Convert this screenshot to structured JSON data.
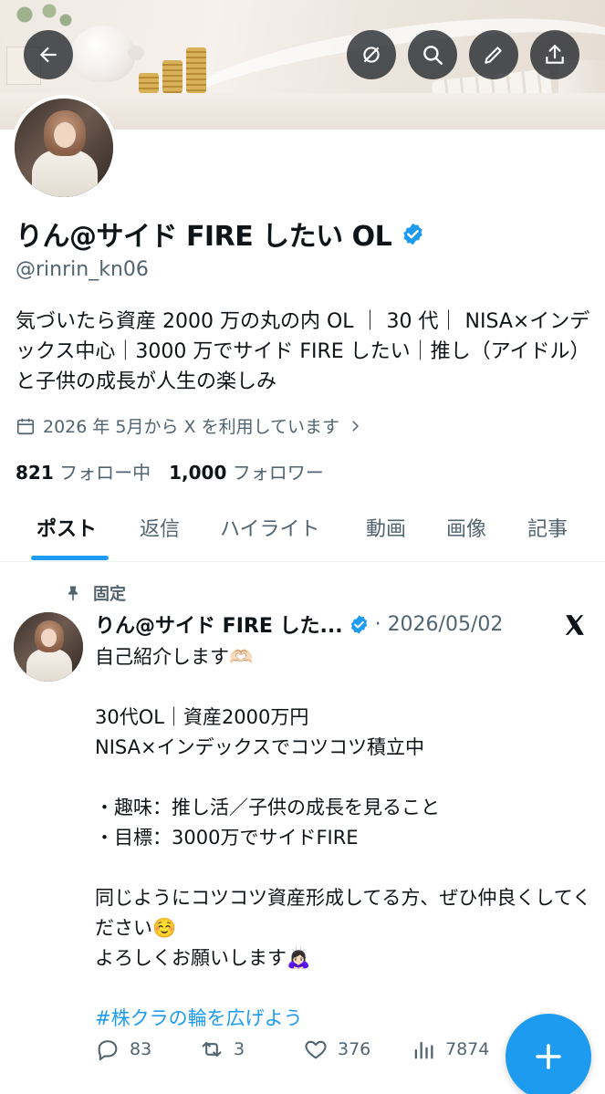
{
  "colors": {
    "accent": "#1d9bf0",
    "text_primary": "#0f1419",
    "text_secondary": "#536471"
  },
  "header": {
    "back_icon": "arrow-left-icon",
    "actions": [
      "translate-off-icon",
      "search-icon",
      "edit-pencil-icon",
      "share-icon"
    ]
  },
  "profile": {
    "name": "りん@サイド FIRE したい OL",
    "handle": "@rinrin_kn06",
    "bio": "気づいたら資産 2000 万の丸の内 OL ｜ 30 代｜ NISA×インデックス中心｜3000 万でサイド FIRE したい｜推し（アイドル）と子供の成長が人生の楽しみ",
    "joined": "2026 年 5月から X を利用しています",
    "following_count": "821",
    "following_label": "フォロー中",
    "followers_count": "1,000",
    "followers_label": "フォロワー"
  },
  "tabs": [
    {
      "label": "ポスト",
      "active": true
    },
    {
      "label": "返信"
    },
    {
      "label": "ハイライト"
    },
    {
      "label": "動画"
    },
    {
      "label": "画像"
    },
    {
      "label": "記事"
    }
  ],
  "post": {
    "pinned_label": "固定",
    "author": "りん@サイド FIRE した...",
    "meta": "· 2026/05/02",
    "lines": [
      "自己紹介します🫶🏻",
      "",
      "30代OL｜資産2000万円",
      "NISA×インデックスでコツコツ積立中",
      "",
      "・趣味：推し活／子供の成長を見ること",
      "・目標：3000万でサイドFIRE",
      "",
      "同じようにコツコツ資産形成してる方、ぜひ仲良くしてください☺️",
      "よろしくお願いします🙇🏻‍♀️"
    ],
    "hashtag": "#株クラの輪を広げよう",
    "replies": "83",
    "reposts": "3",
    "likes": "376",
    "views": "7874"
  },
  "fab_icon": "plus-icon"
}
